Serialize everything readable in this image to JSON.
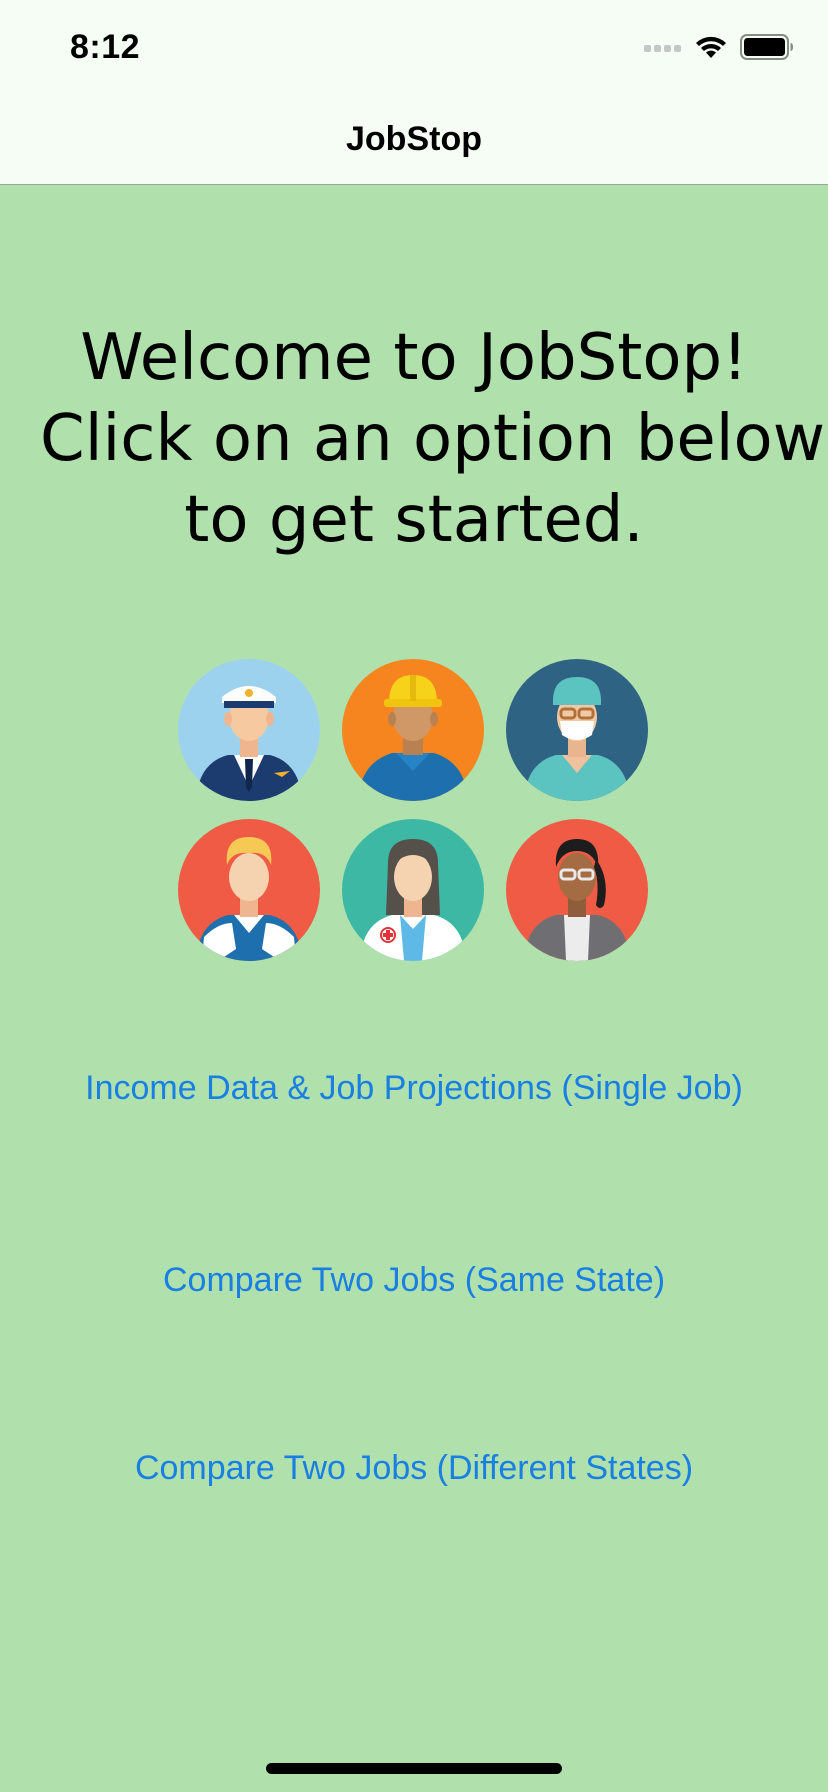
{
  "status_bar": {
    "time": "8:12"
  },
  "nav": {
    "title": "JobStop"
  },
  "welcome": {
    "lines": [
      "Welcome to JobStop!",
      "Click on an option below",
      "to get started."
    ]
  },
  "avatars": [
    {
      "icon": "pilot-avatar-icon",
      "bg": "#9dd2ef"
    },
    {
      "icon": "construction-worker-avatar-icon",
      "bg": "#f6851f"
    },
    {
      "icon": "surgeon-avatar-icon",
      "bg": "#2e6384"
    },
    {
      "icon": "man-avatar-icon",
      "bg": "#f05b45"
    },
    {
      "icon": "doctor-avatar-icon",
      "bg": "#3cb8a4"
    },
    {
      "icon": "businesswoman-avatar-icon",
      "bg": "#f05b45"
    }
  ],
  "actions": [
    {
      "label": "Income Data & Job Projections (Single Job)"
    },
    {
      "label": "Compare Two Jobs (Same State)"
    },
    {
      "label": "Compare Two Jobs (Different States)"
    }
  ],
  "colors": {
    "background": "#b0e1ad",
    "link": "#1a7fe3",
    "nav_bar": "#f6fdf4"
  }
}
